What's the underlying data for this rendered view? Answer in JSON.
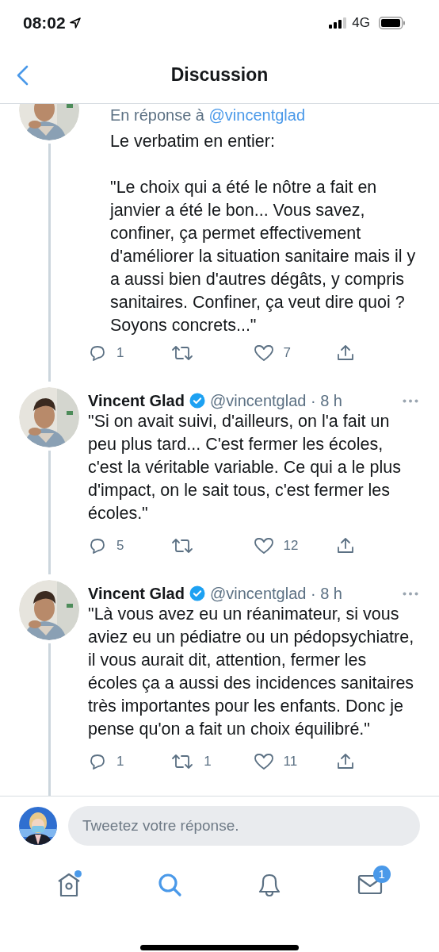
{
  "status_bar": {
    "time": "08:02",
    "network": "4G"
  },
  "header": {
    "title": "Discussion"
  },
  "tweets": [
    {
      "kind": "continued",
      "reply_label": "En réponse à",
      "reply_handle": "@vincentglad",
      "text": "Le verbatim en entier:\n\n\"Le choix qui a été le nôtre a fait en janvier a été le bon... Vous savez, confiner, ça permet effectivement d'améliorer la situation sanitaire mais il y a aussi bien d'autres dégâts, y compris sanitaires. Confiner, ça veut dire quoi ? Soyons concrets...\"",
      "replies": "1",
      "likes": "7"
    },
    {
      "kind": "tweet",
      "name": "Vincent Glad",
      "verified": true,
      "meta": "@vincentglad · 8 h",
      "text": "\"Si on avait suivi, d'ailleurs, on l'a fait un peu plus tard... C'est fermer les écoles, c'est la véritable variable. Ce qui a le plus d'impact, on le sait tous, c'est fermer les écoles.\"",
      "replies": "5",
      "likes": "12"
    },
    {
      "kind": "tweet",
      "name": "Vincent Glad",
      "verified": true,
      "meta": "@vincentglad · 8 h",
      "text": "\"Là vous avez eu un réanimateur, si vous aviez eu un pédiatre ou un pédopsychiatre, il vous aurait dit, attention, fermer les écoles ça a aussi des incidences sanitaires très importantes pour les enfants. Donc je pense qu'on a fait un choix équilibré.\"",
      "replies": "1",
      "retweets": "1",
      "likes": "11"
    }
  ],
  "reply_bar": {
    "placeholder": "Tweetez votre réponse."
  },
  "tab_bar": [
    {
      "kind": "home",
      "selected": false,
      "dot": true
    },
    {
      "kind": "search",
      "selected": true
    },
    {
      "kind": "notifications",
      "selected": false
    },
    {
      "kind": "messages",
      "selected": false,
      "badge": "1"
    }
  ]
}
